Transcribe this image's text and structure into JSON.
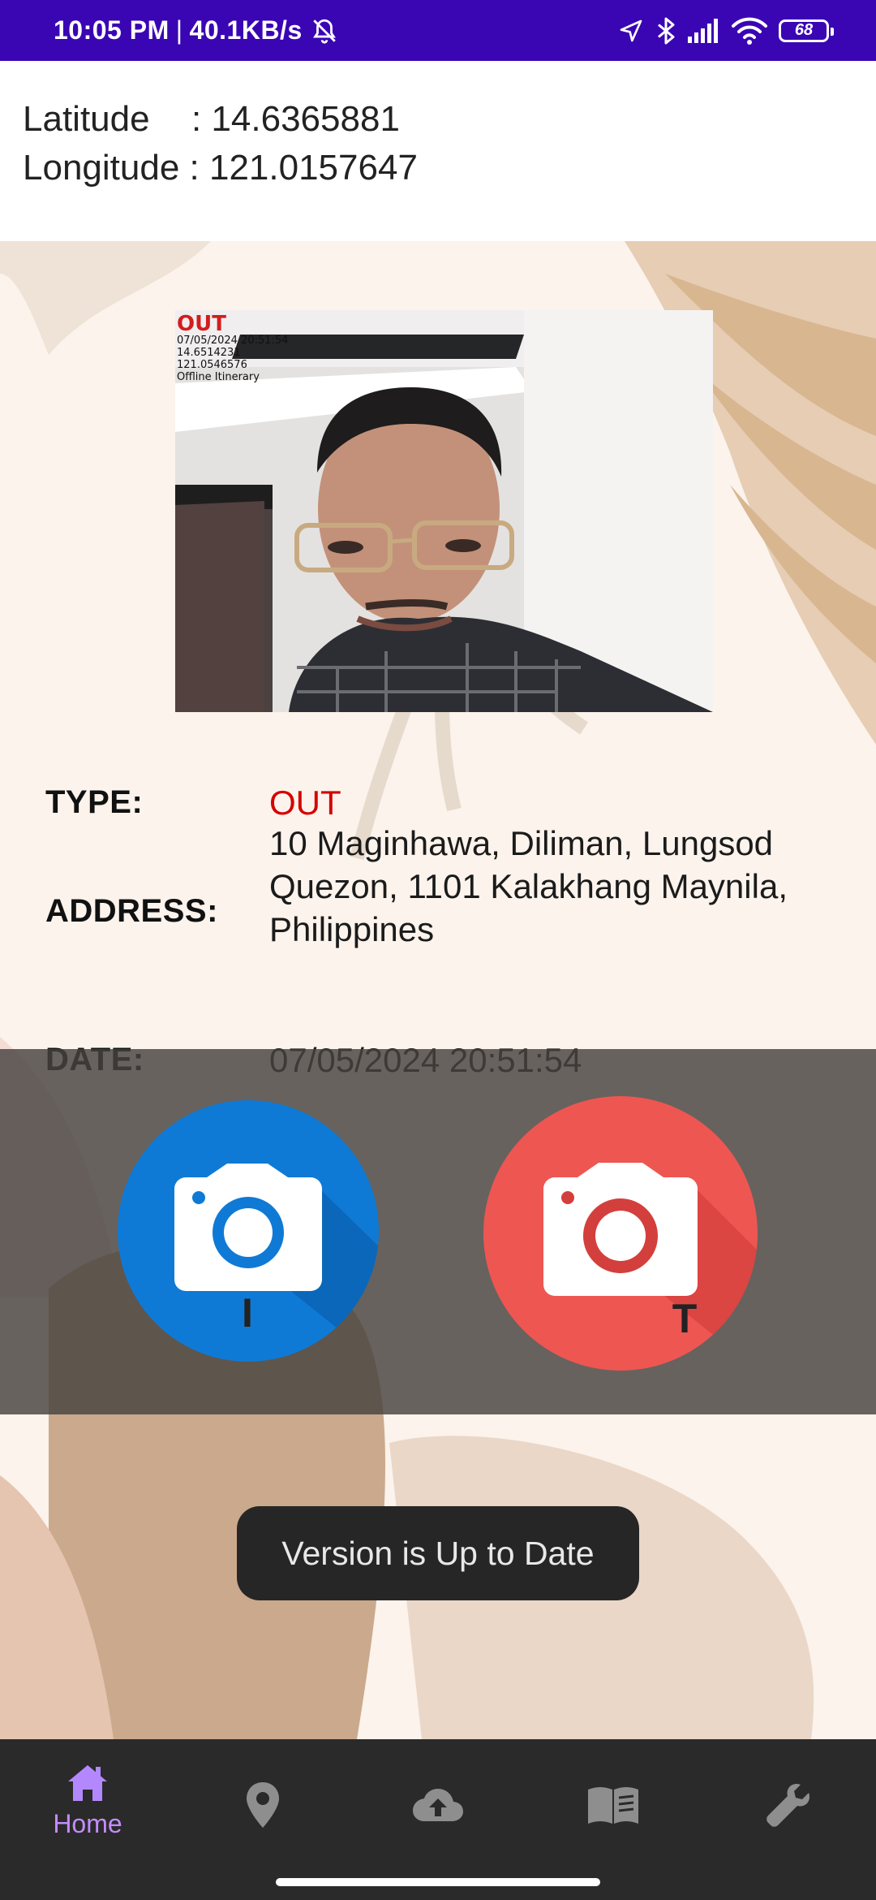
{
  "status_bar": {
    "time": "10:05 PM",
    "separator": "|",
    "net_speed": "40.1KB/s",
    "battery": "68",
    "icons": [
      "bell-off-icon",
      "location-arrow-icon",
      "bluetooth-icon",
      "signal-icon",
      "wifi-icon",
      "battery-icon"
    ]
  },
  "coordinates": {
    "latitude_label": "Latitude",
    "latitude_value": ": 14.6365881",
    "longitude_label": "Longitude",
    "longitude_value": ": 121.0157647"
  },
  "photo": {
    "stamp_type": "OUT",
    "stamp_datetime": "07/05/2024 20:51:54",
    "stamp_lat": "14.6514231",
    "stamp_lon": "121.0546576",
    "stamp_note": "Offline Itinerary"
  },
  "record": {
    "type_label": "TYPE:",
    "type_value": "OUT",
    "address_label": "ADDRESS:",
    "address_value": "10 Maginhawa, Diliman, Lungsod Quezon, 1101 Kalakhang Maynila, Philippines",
    "date_label": "DATE:",
    "date_value": "07/05/2024 20:51:54"
  },
  "actions": {
    "in_button_partial_label": "I",
    "out_button_partial_label": "T"
  },
  "toast": {
    "message": "Version is Up to Date"
  },
  "bottom_nav": {
    "active_color": "#b388ff",
    "inactive_color": "#8e8e8e",
    "items": [
      {
        "icon": "home-icon",
        "label": "Home"
      },
      {
        "icon": "location-pin-icon"
      },
      {
        "icon": "cloud-upload-icon"
      },
      {
        "icon": "book-icon"
      },
      {
        "icon": "wrench-icon"
      }
    ]
  },
  "colors": {
    "status_bar": "#3a06b4",
    "type_out": "#d50000",
    "camera_in": "#0f7ad5",
    "camera_out": "#ee5652"
  }
}
